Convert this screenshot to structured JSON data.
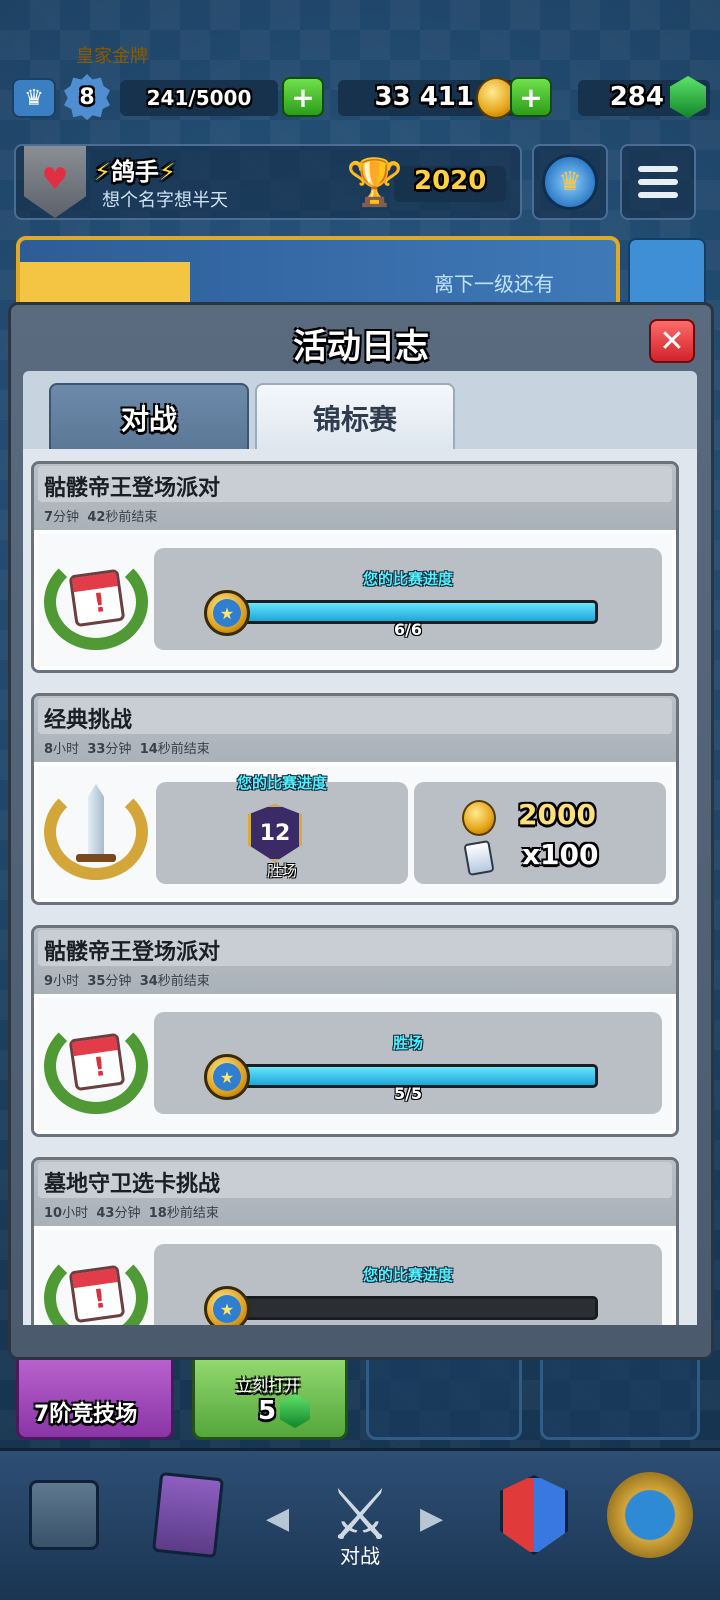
{
  "topbar": {
    "level": "8",
    "xp": "241/5000",
    "gold": "33 411",
    "gems": "284"
  },
  "profile": {
    "name": "鸽手",
    "clan": "想个名字想半天",
    "trophies": "2020"
  },
  "banner": {
    "tag_text": "皇家金牌",
    "next_level_text": "离下一级还有"
  },
  "modal": {
    "title": "活动日志",
    "tabs": [
      {
        "label": "对战",
        "active": false
      },
      {
        "label": "锦标赛",
        "active": true
      }
    ],
    "entries": [
      {
        "title": "骷髅帝王登场派对",
        "time": {
          "a": "7",
          "a_unit": "分钟",
          "b": "42",
          "b_unit": "秒前结束"
        },
        "label": "您的比赛进度",
        "progress_text": "6/6",
        "progress": 1.0
      },
      {
        "title": "经典挑战",
        "time": {
          "a": "8",
          "a_unit": "小时",
          "b": "33",
          "b_unit": "分钟",
          "c": "14",
          "c_unit": "秒前结束"
        },
        "label": "您的比赛进度",
        "wins": "12",
        "wins_label": "胜场",
        "reward_gold": "2000",
        "reward_cards": "x100"
      },
      {
        "title": "骷髅帝王登场派对",
        "time": {
          "a": "9",
          "a_unit": "小时",
          "b": "35",
          "b_unit": "分钟",
          "c": "34",
          "c_unit": "秒前结束"
        },
        "label": "胜场",
        "progress_text": "5/5",
        "progress": 1.0
      },
      {
        "title": "墓地守卫选卡挑战",
        "time": {
          "a": "10",
          "a_unit": "小时",
          "b": "43",
          "b_unit": "分钟",
          "c": "18",
          "c_unit": "秒前结束"
        },
        "label": "您的比赛进度",
        "progress": 0.0
      }
    ]
  },
  "chests": {
    "slot1_label": "7阶竞技场",
    "slot2_label": "立刻打开",
    "slot2_cost": "5"
  },
  "bottomnav": {
    "battle_label": "对战"
  },
  "colors": {
    "accent_cyan": "#4ff0ff",
    "progress_fill": "#1ea6d8",
    "close_red": "#d1232a",
    "plus_green": "#2c9d1b"
  }
}
